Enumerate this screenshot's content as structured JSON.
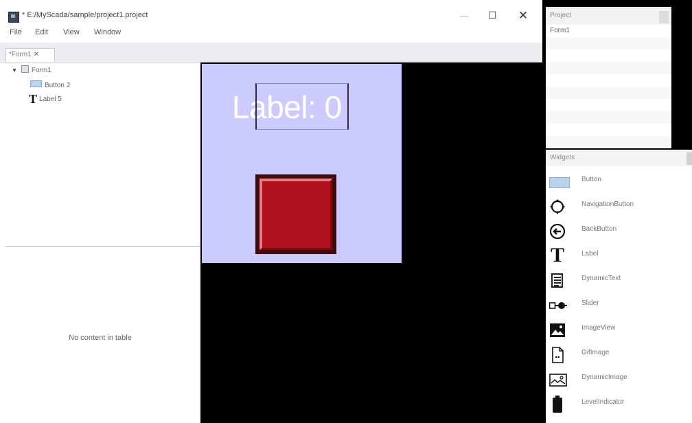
{
  "window": {
    "title": "* E:/MyScada/sample/project1.project",
    "minimize": "—",
    "maximize": "☐",
    "close": "✕"
  },
  "menu": [
    "File",
    "Edit",
    "View",
    "Window"
  ],
  "tabs": [
    {
      "label": "*Form1",
      "close": "✕"
    }
  ],
  "tree": {
    "expand_glyph": "▼",
    "root": "Form1",
    "children": [
      {
        "label": "Button 2",
        "icon": "button-icon"
      },
      {
        "label": "Label 5",
        "icon": "label-t-icon",
        "glyph": "T"
      }
    ]
  },
  "table": {
    "empty_text": "No content in table"
  },
  "canvas": {
    "background": "#cccbff",
    "label_text": "Label: 0",
    "button_color": "#b0121d"
  },
  "project": {
    "header": "Project",
    "items": [
      "Form1"
    ]
  },
  "widgets": {
    "header": "Widgets",
    "items": [
      {
        "label": "Button",
        "icon": "button-icon"
      },
      {
        "label": "NavigationButton",
        "icon": "navigation-icon"
      },
      {
        "label": "BackButton",
        "icon": "back-arrow-icon"
      },
      {
        "label": "Label",
        "icon": "label-t-icon",
        "glyph": "T"
      },
      {
        "label": "DynamicText",
        "icon": "document-icon"
      },
      {
        "label": "Slider",
        "icon": "slider-icon"
      },
      {
        "label": "ImageView",
        "icon": "image-icon"
      },
      {
        "label": "GifImage",
        "icon": "gif-file-icon"
      },
      {
        "label": "DynamicImage",
        "icon": "dynamic-image-icon"
      },
      {
        "label": "LevelIndicator",
        "icon": "battery-icon"
      }
    ]
  }
}
